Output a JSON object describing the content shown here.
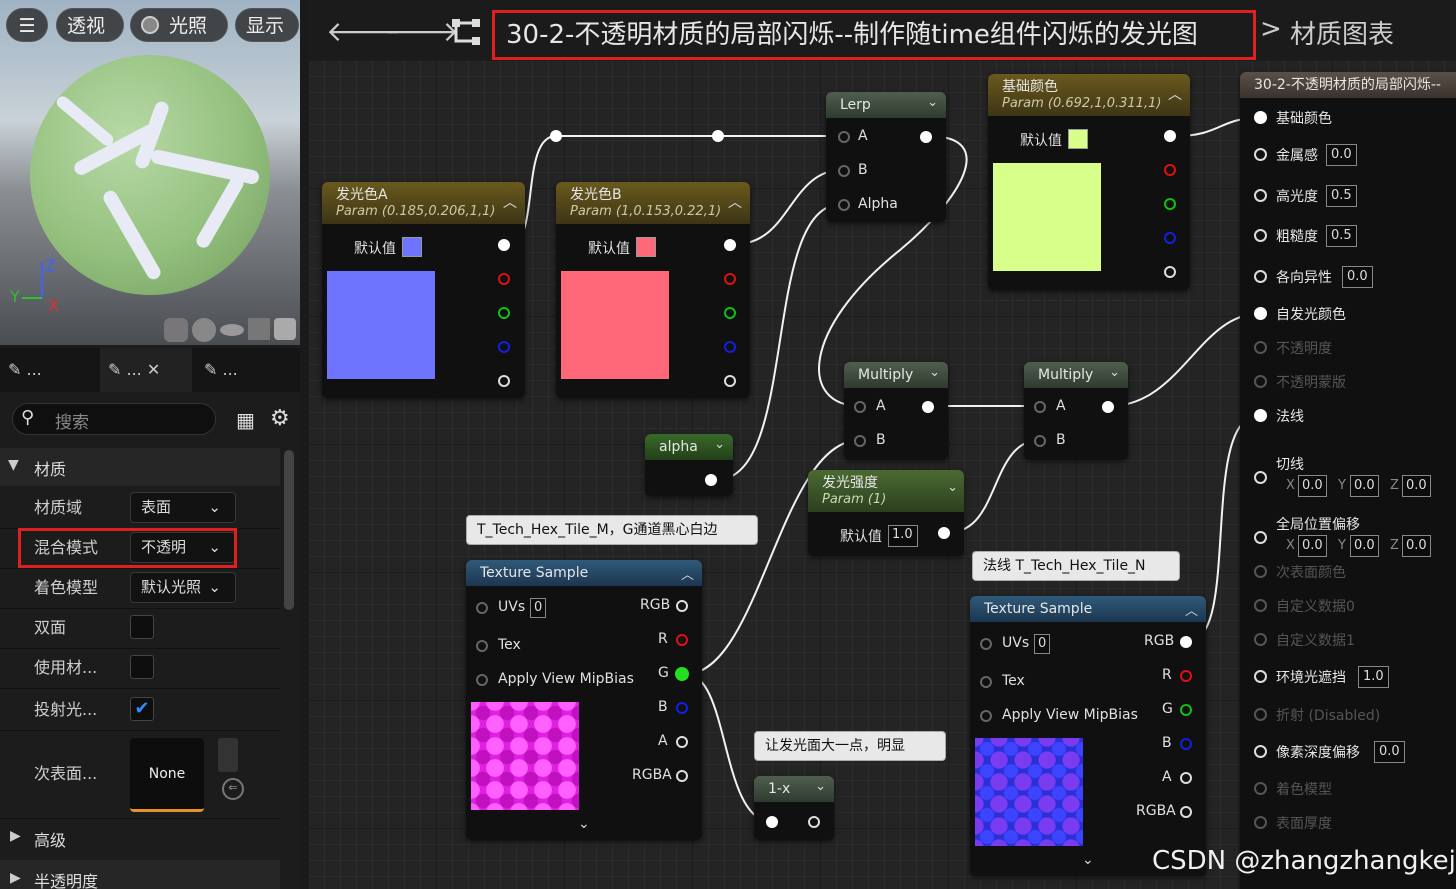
{
  "viewport": {
    "perspective": "透视",
    "lighting": "光照",
    "show": "显示",
    "axis_z": "Z",
    "axis_y": "Y",
    "axis_x": "X"
  },
  "tabs": [
    "...",
    "...",
    "..."
  ],
  "search_placeholder": "搜索",
  "details": {
    "section_material": "材质",
    "rows": [
      {
        "label": "材质域",
        "value": "表面"
      },
      {
        "label": "混合模式",
        "value": "不透明"
      },
      {
        "label": "着色模型",
        "value": "默认光照"
      },
      {
        "label": "双面",
        "value": ""
      },
      {
        "label": "使用材...",
        "value": ""
      },
      {
        "label": "投射光...",
        "value": ""
      },
      {
        "label": "次表面...",
        "value": "None"
      }
    ],
    "section_advanced": "高级",
    "section_translucency": "半透明度"
  },
  "title": {
    "graph_name": "30-2-不透明材质的局部闪烁--制作随time组件闪烁的发光图",
    "separator": ">",
    "crumb": "材质图表"
  },
  "nodes": {
    "colorA": {
      "title": "发光色A",
      "sub": "Param (0.185,0.206,1,1)",
      "default": "默认值",
      "color": "#6f74ff"
    },
    "colorB": {
      "title": "发光色B",
      "sub": "Param (1,0.153,0.22,1)",
      "default": "默认值",
      "color": "#ff6878"
    },
    "base": {
      "title": "基础颜色",
      "sub": "Param (0.692,1,0.311,1)",
      "default": "默认值",
      "color": "#d8ff8a"
    },
    "lerp": {
      "title": "Lerp",
      "a": "A",
      "b": "B",
      "alpha": "Alpha"
    },
    "alpha": {
      "title": "alpha"
    },
    "multiply1": {
      "title": "Multiply",
      "a": "A",
      "b": "B"
    },
    "multiply2": {
      "title": "Multiply",
      "a": "A",
      "b": "B"
    },
    "intensity": {
      "title": "发光强度",
      "sub": "Param (1)",
      "default": "默认值",
      "value": "1.0"
    },
    "tex1": {
      "comment": "T_Tech_Hex_Tile_M，G通道黑心白边",
      "title": "Texture Sample",
      "uvs": "UVs",
      "uv_val": "0",
      "tex": "Tex",
      "mip": "Apply View MipBias",
      "rgb": "RGB",
      "r": "R",
      "g": "G",
      "b": "B",
      "a": "A",
      "rgba": "RGBA"
    },
    "tex2": {
      "comment": "法线 T_Tech_Hex_Tile_N",
      "title": "Texture Sample",
      "uvs": "UVs",
      "uv_val": "0",
      "tex": "Tex",
      "mip": "Apply View MipBias",
      "rgb": "RGB",
      "r": "R",
      "g": "G",
      "b": "B",
      "a": "A",
      "rgba": "RGBA"
    },
    "oneminus": {
      "comment": "让发光面大一点，明显",
      "title": "1-x"
    }
  },
  "result": {
    "title": "30-2-不透明材质的局部闪烁--",
    "pins": [
      {
        "label": "基础颜色",
        "value": ""
      },
      {
        "label": "金属感",
        "value": "0.0"
      },
      {
        "label": "高光度",
        "value": "0.5"
      },
      {
        "label": "粗糙度",
        "value": "0.5"
      },
      {
        "label": "各向异性",
        "value": "0.0"
      },
      {
        "label": "自发光颜色",
        "value": ""
      },
      {
        "label": "不透明度",
        "value": ""
      },
      {
        "label": "不透明蒙版",
        "value": ""
      },
      {
        "label": "法线",
        "value": ""
      },
      {
        "label": "切线",
        "value": ""
      },
      {
        "label": "全局位置偏移",
        "value": ""
      },
      {
        "label": "次表面颜色",
        "value": ""
      },
      {
        "label": "自定义数据0",
        "value": ""
      },
      {
        "label": "自定义数据1",
        "value": ""
      },
      {
        "label": "环境光遮挡",
        "value": "1.0"
      },
      {
        "label": "折射 (Disabled)",
        "value": ""
      },
      {
        "label": "像素深度偏移",
        "value": "0.0"
      },
      {
        "label": "着色模型",
        "value": ""
      },
      {
        "label": "表面厚度",
        "value": ""
      }
    ],
    "xyz": {
      "x": "X",
      "y": "Y",
      "z": "Z",
      "zero": "0.0"
    }
  },
  "watermark": "CSDN @zhangzhangkeji",
  "colors": {
    "highlight": "#e02020",
    "accent": "#1e6fd9"
  }
}
